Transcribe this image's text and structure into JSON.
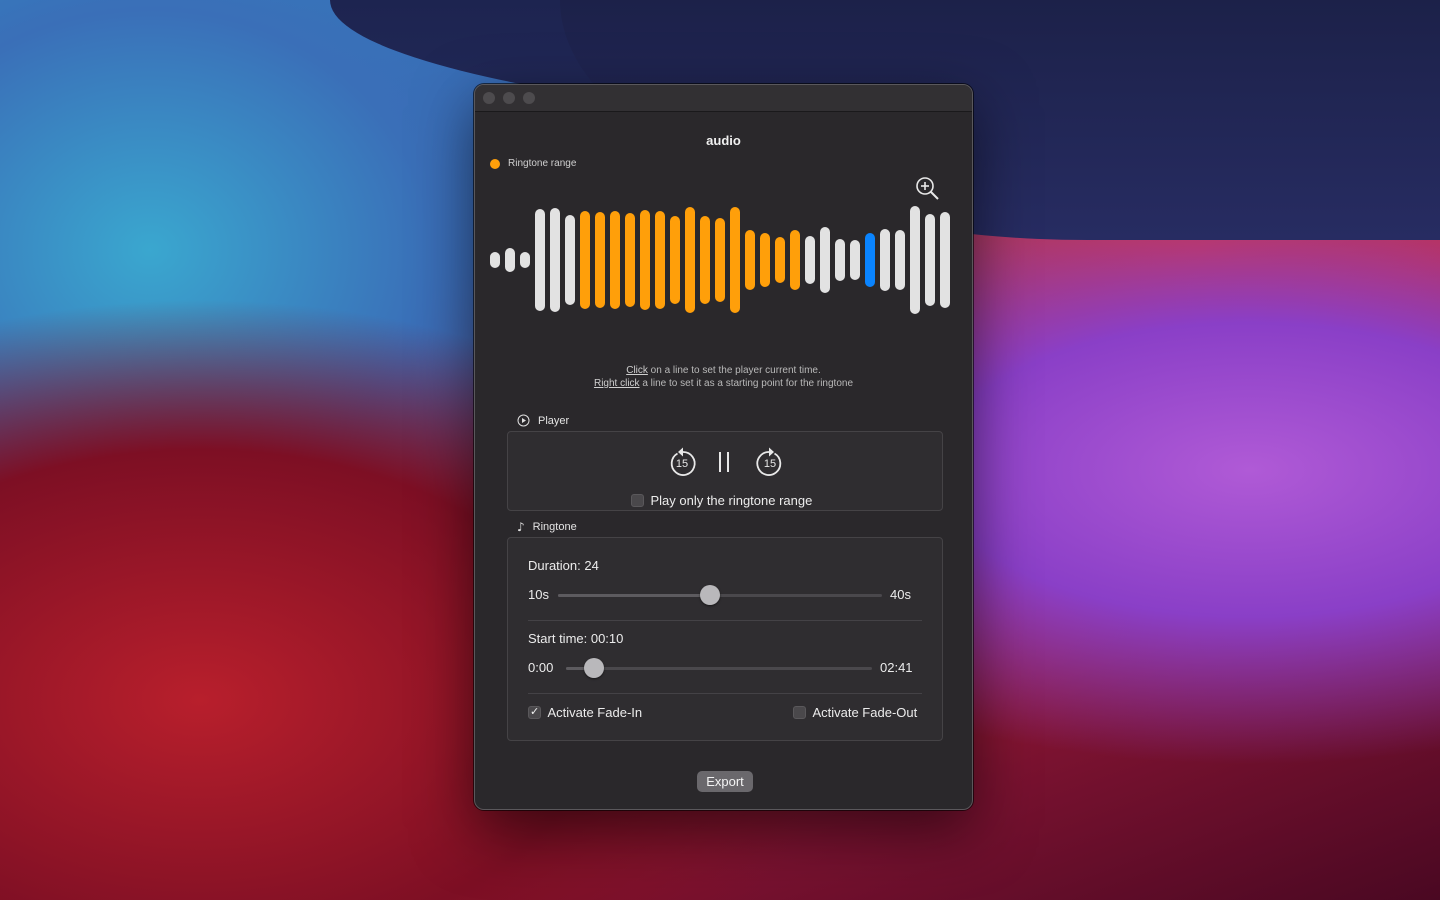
{
  "window": {
    "title": "audio"
  },
  "legend": {
    "label": "Ringtone range",
    "color": "#ff9f0a"
  },
  "colors": {
    "in_range": "#ff9f0a",
    "playhead": "#0a84ff",
    "default": "#e2e2e2"
  },
  "waveform": {
    "bars": [
      {
        "h": 0.13,
        "s": "default"
      },
      {
        "h": 0.2,
        "s": "default"
      },
      {
        "h": 0.13,
        "s": "default"
      },
      {
        "h": 0.85,
        "s": "default"
      },
      {
        "h": 0.87,
        "s": "default"
      },
      {
        "h": 0.75,
        "s": "default"
      },
      {
        "h": 0.82,
        "s": "range"
      },
      {
        "h": 0.8,
        "s": "range"
      },
      {
        "h": 0.82,
        "s": "range"
      },
      {
        "h": 0.78,
        "s": "range"
      },
      {
        "h": 0.84,
        "s": "range"
      },
      {
        "h": 0.82,
        "s": "range"
      },
      {
        "h": 0.74,
        "s": "range"
      },
      {
        "h": 0.88,
        "s": "range"
      },
      {
        "h": 0.74,
        "s": "range"
      },
      {
        "h": 0.7,
        "s": "range"
      },
      {
        "h": 0.88,
        "s": "range"
      },
      {
        "h": 0.5,
        "s": "range"
      },
      {
        "h": 0.45,
        "s": "range"
      },
      {
        "h": 0.38,
        "s": "range"
      },
      {
        "h": 0.5,
        "s": "range"
      },
      {
        "h": 0.4,
        "s": "default"
      },
      {
        "h": 0.55,
        "s": "default"
      },
      {
        "h": 0.35,
        "s": "default"
      },
      {
        "h": 0.34,
        "s": "default"
      },
      {
        "h": 0.45,
        "s": "playhead"
      },
      {
        "h": 0.52,
        "s": "default"
      },
      {
        "h": 0.5,
        "s": "default"
      },
      {
        "h": 0.9,
        "s": "default"
      },
      {
        "h": 0.76,
        "s": "default"
      },
      {
        "h": 0.8,
        "s": "default"
      }
    ]
  },
  "hint": {
    "line1_link": "Click",
    "line1_rest": " on a line to set the player current time.",
    "line2_link": "Right click",
    "line2_rest": " a line to set it as a starting point for the ringtone"
  },
  "player": {
    "section_label": "Player",
    "skip_back_label": "15",
    "skip_forward_label": "15",
    "play_only_range_label": "Play only the ringtone range",
    "play_only_range_checked": false
  },
  "ringtone": {
    "section_label": "Ringtone",
    "duration_label": "Duration: 24",
    "duration_min": "10s",
    "duration_max": "40s",
    "duration_fraction": 0.47,
    "start_label": "Start time: 00:10",
    "start_min": "0:00",
    "start_max": "02:41",
    "start_fraction": 0.09,
    "fade_in_label": "Activate Fade-In",
    "fade_in_checked": true,
    "fade_out_label": "Activate Fade-Out",
    "fade_out_checked": false
  },
  "export_label": "Export"
}
